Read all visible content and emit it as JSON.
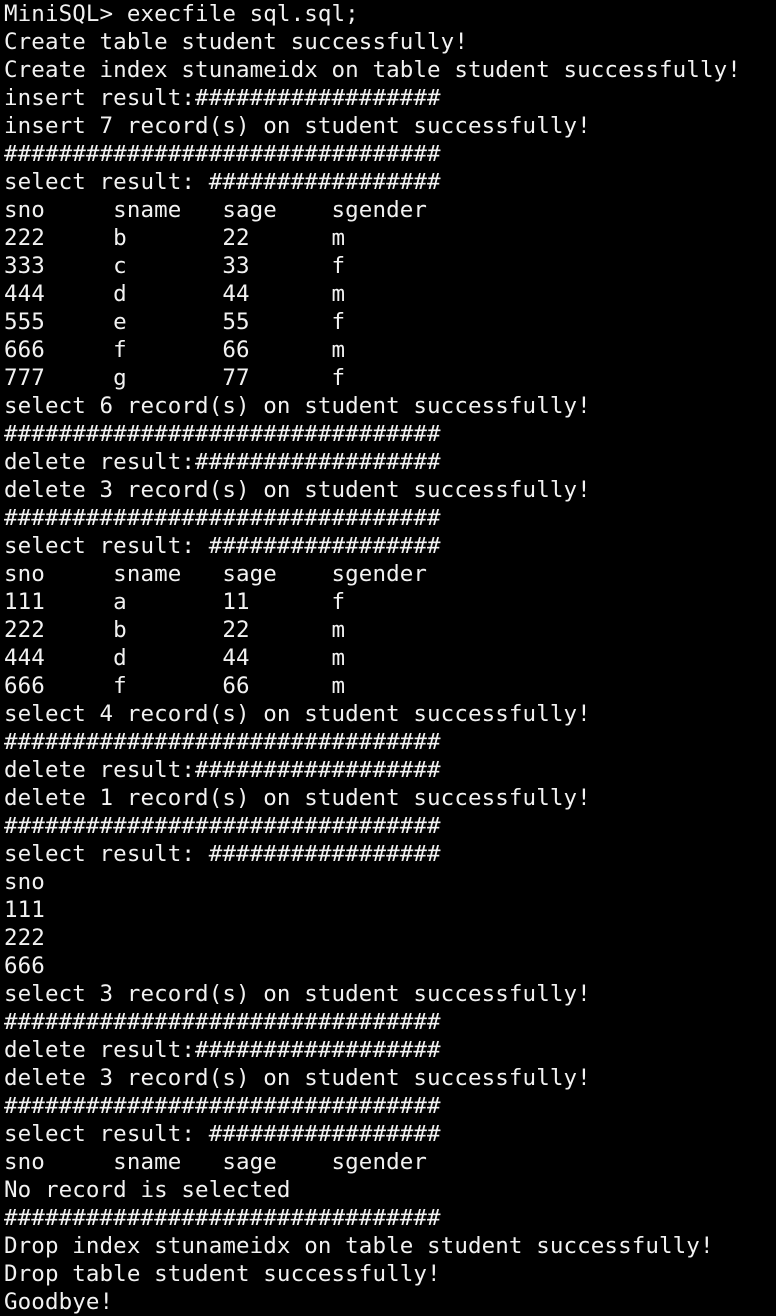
{
  "terminal": {
    "lines": [
      "MiniSQL> execfile sql.sql;",
      "Create table student successfully!",
      "Create index stunameidx on table student successfully!",
      "insert result:##################",
      "insert 7 record(s) on student successfully!",
      "################################",
      "select result: #################",
      "sno     sname   sage    sgender",
      "222     b       22      m",
      "333     c       33      f",
      "444     d       44      m",
      "555     e       55      f",
      "666     f       66      m",
      "777     g       77      f",
      "select 6 record(s) on student successfully!",
      "################################",
      "delete result:##################",
      "delete 3 record(s) on student successfully!",
      "################################",
      "select result: #################",
      "sno     sname   sage    sgender",
      "111     a       11      f",
      "222     b       22      m",
      "444     d       44      m",
      "666     f       66      m",
      "select 4 record(s) on student successfully!",
      "################################",
      "delete result:##################",
      "delete 1 record(s) on student successfully!",
      "################################",
      "select result: #################",
      "sno",
      "111",
      "222",
      "666",
      "select 3 record(s) on student successfully!",
      "################################",
      "delete result:##################",
      "delete 3 record(s) on student successfully!",
      "################################",
      "select result: #################",
      "sno     sname   sage    sgender",
      "No record is selected",
      "################################",
      "Drop index stunameidx on table student successfully!",
      "Drop table student successfully!",
      "Goodbye!"
    ]
  }
}
